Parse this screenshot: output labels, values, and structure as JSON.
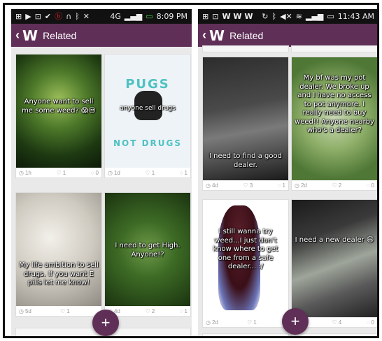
{
  "colors": {
    "appbar": "#5f2f57",
    "statusbar": "#111111",
    "fab": "#5f2f57"
  },
  "left": {
    "status": {
      "time": "8:09 PM",
      "network": "4G"
    },
    "appbar": {
      "back_icon": "chevron-left",
      "logo": "W",
      "title": "Related"
    },
    "cards": [
      {
        "caption": "Anyone want to sell me some weed? 😱😒",
        "time": "1h",
        "likes": "1",
        "comments": "0"
      },
      {
        "caption": "anyone sell drugs",
        "top_text": "PUGS",
        "bottom_text": "NOT DRUGS",
        "time": "1d",
        "likes": "1",
        "comments": "1"
      },
      {
        "caption": "My life ambition to sell drugs. If you want E pills let me know!",
        "time": "5d",
        "likes": "1",
        "comments": ""
      },
      {
        "caption": "I need to get High. Anyone!?",
        "time": "4d",
        "likes": "2",
        "comments": "1"
      }
    ],
    "fab": "+"
  },
  "right": {
    "status": {
      "time": "11:43 AM",
      "apps": "W W W"
    },
    "appbar": {
      "back_icon": "chevron-left",
      "logo": "W",
      "title": "Related"
    },
    "cards": [
      {
        "caption": "I need to find a good dealer.",
        "time": "4d",
        "likes": "3",
        "comments": "1"
      },
      {
        "caption": "My bf was my pot dealer. We broke up and I have no access to pot anymore. I really need to buy weed!! Anyone nearby who's a dealer?",
        "time": "2d",
        "likes": "2",
        "comments": "0"
      },
      {
        "caption": "I still wanna try weed...I just don't know where to get one from a safe dealer... :/",
        "time": "2d",
        "likes": "1",
        "comments": ""
      },
      {
        "caption": "I need a new dealer 😄",
        "time": "2d",
        "likes": "4",
        "comments": "0"
      }
    ],
    "fab": "+"
  }
}
